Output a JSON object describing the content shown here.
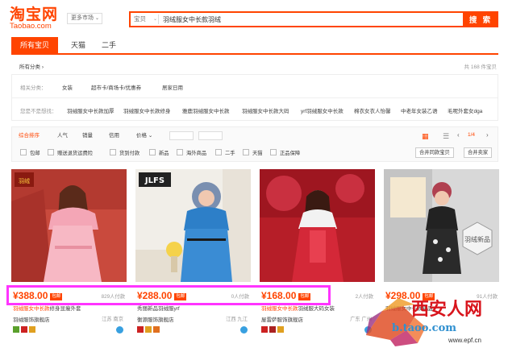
{
  "header": {
    "logo_cn": "淘宝网",
    "logo_en": "Taobao.com",
    "market_label": "更多市场",
    "search_category": "宝贝",
    "search_query": "羽绒服女中长款羽绒",
    "search_button": "搜 索"
  },
  "tabs": [
    "所有宝贝",
    "天猫",
    "二手"
  ],
  "breadcrumb": "所有分类",
  "breadcrumb_arrow": "›",
  "result_count": "共 168 件宝贝",
  "related": {
    "label": "相关分类：",
    "items": [
      "女装",
      "超市卡/商场卡/优惠券",
      "居家日用"
    ]
  },
  "suggest": {
    "label": "您是不是想找：",
    "items": [
      "羽绒服女中长款加厚",
      "羽绒服女中长款修身",
      "雅鹿羽绒服女中长款",
      "羽绒服女中长款大码",
      "yrf羽绒服女中长款",
      "棉衣女衣人怡馨",
      "中老年女装乙语",
      "毛呢外套女dga"
    ]
  },
  "sort": {
    "options": [
      "综合排序",
      "人气",
      "销量",
      "信用",
      "价格"
    ],
    "price_chevron": "⌄",
    "price_dash": "-",
    "page": "1/4",
    "grid_icon": "▦",
    "list_icon": "☰",
    "prev_icon": "‹",
    "next_icon": "›"
  },
  "checkboxes": [
    "包邮",
    "赠送退货运费险",
    "货到付款",
    "新品",
    "海外商品",
    "二手",
    "天猫",
    "正品保障"
  ],
  "buttons": {
    "merge_same": "合并同款宝贝",
    "merge_shop": "合并卖家"
  },
  "products": [
    {
      "price": "¥388.00",
      "badge": "包邮",
      "sold": "829人付款",
      "title_hl": "羽绒服女中长款",
      "title_rest": "修身显瘦外套",
      "shop": "羽绒服饰旗舰店",
      "location": "江苏 南京",
      "brand": "羽绒"
    },
    {
      "price": "¥288.00",
      "badge": "包邮",
      "sold": "0人付款",
      "title_hl": "",
      "title_rest": "秀丽新品羽绒服yrf",
      "shop": "衡源服饰旗舰店",
      "location": "江西 九江",
      "brand": "JLFS"
    },
    {
      "price": "¥168.00",
      "badge": "包邮",
      "sold": "2人付款",
      "title_hl": "羽绒服女中长款",
      "title_rest": "羽绒服大码女装",
      "shop": "屋雷萨服饰旗舰店",
      "location": "广东 广州",
      "brand": ""
    },
    {
      "price": "¥298.00",
      "badge": "包邮",
      "sold": "91人付款",
      "title_hl": "",
      "title_rest": "羽绒服女中长款新品",
      "shop": "",
      "location": "",
      "brand": "羽绒新品"
    }
  ],
  "watermark": {
    "cn": "西安人网",
    "url_partial": "b.taoo.com",
    "url": "www.epf.cn"
  },
  "colors": {
    "accent": "#ff4400",
    "highlight": "#ff34ff",
    "wangwang": "#38a0e0"
  }
}
